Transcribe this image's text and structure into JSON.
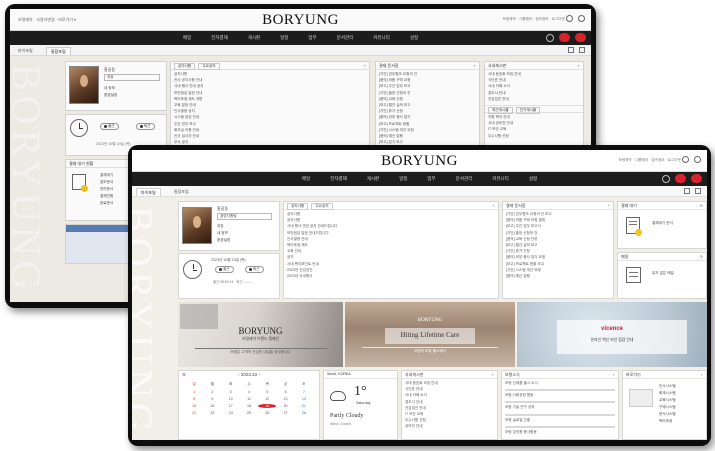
{
  "brand": {
    "logo_text": "BORYUNG",
    "watermark": "BORYUNG",
    "accent": "#d9242f"
  },
  "back_window": {
    "top_links": "보령제약 · 사용자변경 · 바로가기 ▾",
    "top_right": "보령제약 · 그룹웨어 · 접속정보 · 로그아웃",
    "nav": [
      "메일",
      "전자결재",
      "게시판",
      "일정",
      "업무",
      "문서관리",
      "커뮤니티",
      "설정"
    ],
    "tabs": [
      "마이포털",
      "통합포털"
    ],
    "profile": {
      "name": "홍길동",
      "title": "과장",
      "menu": [
        "내 정보",
        "환경설정"
      ]
    },
    "clock_buttons": [
      "출근",
      "퇴근"
    ],
    "clock_date": "2023년 10월 19일 (목)",
    "approval_head": "결재 대기 현황",
    "approval_items": [
      "결재대기",
      "참조문서",
      "반려문서",
      "결재진행",
      "완료문서"
    ],
    "panel_a": {
      "title": "공지사항",
      "tab2": "주요공지",
      "rows": [
        "공지사항",
        "전사 공지사항 안내",
        "사내 행사 안내 공지",
        "보안점검 일정 안내",
        "복리후생 제도 개편",
        "교육 일정 안내",
        "인사발령 공지",
        "시스템 점검 안내",
        "주간 업무 보고",
        "회의실 이용 안내",
        "신규 입사자 안내",
        "부서 공지",
        "전사 공지",
        "사내소식"
      ]
    },
    "panel_b": {
      "title": "결재 문서함",
      "rows": [
        "[기안] 업무협조 요청의 건",
        "[품의] 비품 구매 요청",
        "[보고] 주간 업무 보고",
        "[기안] 출장 신청의 건",
        "[품의] 교육 신청",
        "[보고] 월간 실적 보고",
        "[기안] 휴가 신청",
        "[품의] 외부 행사 참가",
        "[보고] 프로젝트 현황",
        "[기안] 시스템 개선 요청",
        "[품의] 예산 집행",
        "[보고] 분기 보고"
      ]
    },
    "panel_c": {
      "title": "사내게시판",
      "rows": [
        "사내 동호회 모집 안내",
        "식단표 안내",
        "사내 카페 소식",
        "경조사 안내",
        "건강검진 안내"
      ],
      "tabs2": [
        "최근게시물",
        "인기게시물"
      ],
      "rows2": [
        "직원 복지 안내",
        "사내 공모전 안내",
        "IT 보안 교육",
        "우수사원 선정"
      ]
    }
  },
  "front_window": {
    "top_right": "보령제약 · 그룹웨어 · 접속정보 · 로그아웃",
    "nav": [
      "메일",
      "전자결재",
      "게시판",
      "일정",
      "업무",
      "문서관리",
      "커뮤니티",
      "설정"
    ],
    "tabs": [
      "마이포털",
      "통합포털"
    ],
    "profile": {
      "name": "홍길동",
      "dept": "경영지원팀",
      "title": "과장",
      "menu": [
        "내 정보",
        "환경설정"
      ]
    },
    "clock_date": "2023년 10월 19일 (목)",
    "clock_buttons": [
      "출근",
      "퇴근"
    ],
    "clock_note": "출근 08:52:14 · 퇴근 --:--:--",
    "notice": {
      "title": "공지사항",
      "tab2": "주요공지",
      "rows": [
        "공지사항",
        "공지사항",
        "사내 행사 관련 공지 안내드립니다",
        "보안점검 일정 안내드립니다",
        "인사발령 안내",
        "복리후생 제도",
        "교육 안내",
        "공지",
        "사내 복지포인트 안내",
        "2023년 건강검진",
        "2023년 사내행사"
      ]
    },
    "approval": {
      "title": "결재 문서함",
      "rows": [
        "[기안] 업무협조 요청의 건 보고",
        "[품의] 비품 구매 요청 결재",
        "[보고] 주간 업무 보고서",
        "[기안] 출장 신청의 건",
        "[품의] 교육 신청 관련",
        "[보고] 월간 실적 보고",
        "[기안] 휴가 신청",
        "[품의] 외부 행사 참가 요청",
        "[보고] 프로젝트 현황 보고",
        "[기안] 시스템 개선 요청",
        "[품의] 예산 집행"
      ]
    },
    "wait_widget": {
      "title": "결재 대기",
      "text": "결재대기 문서"
    },
    "mail_widget": {
      "title": "메일",
      "text": "읽지 않은 메일"
    },
    "banners": [
      {
        "logo": "BORYUNG",
        "sub": "보령제약 브랜드 캠페인",
        "cap": "보령은 고객의 건강한 내일을 생각합니다"
      },
      {
        "logo": "BORYUNG",
        "main": "Hiting Lifetime Care",
        "cap": "보령의 토탈 헬스케어"
      },
      {
        "logo": "vicence",
        "cap": "온라인 백신 보안 점검 안내"
      }
    ],
    "calendar": {
      "title": "2023.10",
      "weekdays": [
        "일",
        "월",
        "화",
        "수",
        "목",
        "금",
        "토"
      ],
      "days": [
        "1",
        "2",
        "3",
        "4",
        "5",
        "6",
        "7",
        "8",
        "9",
        "10",
        "11",
        "12",
        "13",
        "14",
        "15",
        "16",
        "17",
        "18",
        "19",
        "20",
        "21",
        "22",
        "23",
        "24",
        "25",
        "26",
        "27",
        "28"
      ],
      "today": "19"
    },
    "weather": {
      "city": "Seoul, KOREA",
      "label": "Partly Cloudy",
      "temp": "1°",
      "sub": "Saturday",
      "wind": "Wind: 4 km/h"
    },
    "board": {
      "title": "사내게시판",
      "rows": [
        "사내 동호회 모집 안내",
        "식단표 안내",
        "사내 카페 소식",
        "경조사 안내",
        "건강검진 안내",
        "IT 보안 교육",
        "우수사원 선정",
        "공모전 안내"
      ]
    },
    "news": {
      "title": "보령소식",
      "rows": [
        "보령 신제품 출시 소식",
        "보령 사회공헌 활동",
        "보령 기술 연구 성과",
        "보령 글로벌 진출",
        "보령 임직원 봉사활동"
      ]
    },
    "quick": {
      "title": "바로가기",
      "rows": [
        "인사시스템",
        "회계시스템",
        "교육시스템",
        "구매시스템",
        "문서시스템",
        "복리후생"
      ]
    }
  }
}
